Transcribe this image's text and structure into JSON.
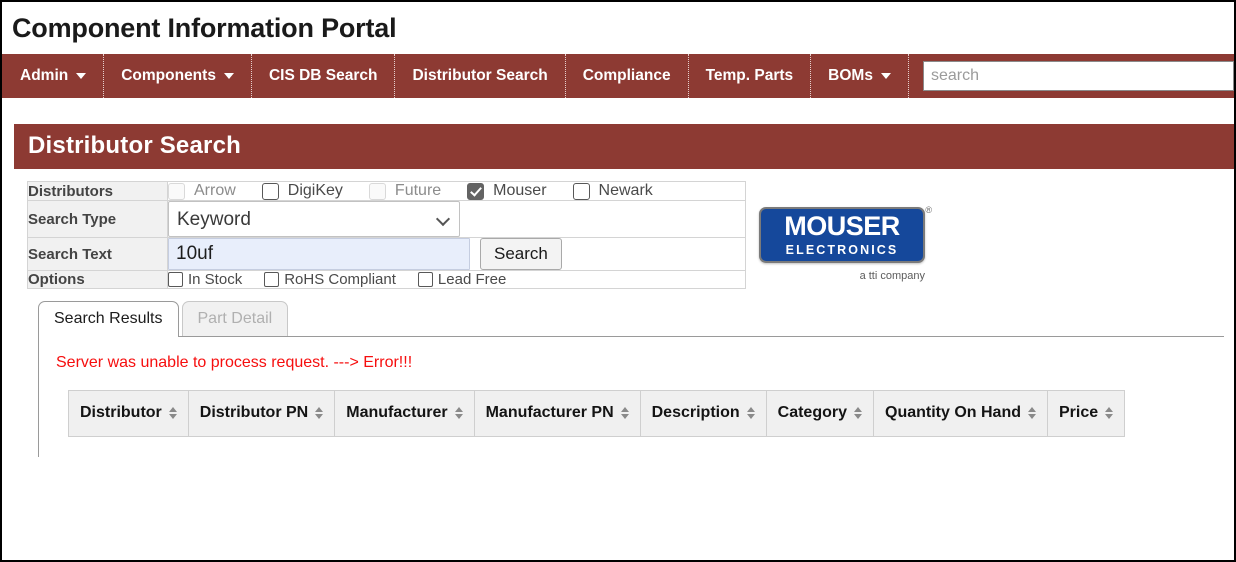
{
  "app": {
    "title": "Component Information Portal"
  },
  "nav": {
    "items": [
      {
        "label": "Admin",
        "has_caret": true
      },
      {
        "label": "Components",
        "has_caret": true
      },
      {
        "label": "CIS DB Search",
        "has_caret": false
      },
      {
        "label": "Distributor Search",
        "has_caret": false
      },
      {
        "label": "Compliance",
        "has_caret": false
      },
      {
        "label": "Temp. Parts",
        "has_caret": false
      },
      {
        "label": "BOMs",
        "has_caret": true
      }
    ],
    "search": {
      "value": "",
      "placeholder": "search"
    }
  },
  "panel": {
    "header": "Distributor Search",
    "form": {
      "distributors_label": "Distributors",
      "distributors": [
        {
          "label": "Arrow",
          "checked": false,
          "disabled": true
        },
        {
          "label": "DigiKey",
          "checked": false,
          "disabled": false
        },
        {
          "label": "Future",
          "checked": false,
          "disabled": true
        },
        {
          "label": "Mouser",
          "checked": true,
          "disabled": false
        },
        {
          "label": "Newark",
          "checked": false,
          "disabled": false
        }
      ],
      "search_type_label": "Search Type",
      "search_type_value": "Keyword",
      "search_type_options": [
        "Keyword"
      ],
      "search_text_label": "Search Text",
      "search_text_value": "10uf",
      "search_button": "Search",
      "options_label": "Options",
      "options": [
        {
          "label": "In Stock",
          "checked": false
        },
        {
          "label": "RoHS Compliant",
          "checked": false
        },
        {
          "label": "Lead Free",
          "checked": false
        }
      ]
    },
    "logo": {
      "main": "MOUSER",
      "sub": "ELECTRONICS",
      "registered": "®",
      "tagline": "a tti company",
      "color": "#15489b"
    }
  },
  "tabs": [
    {
      "label": "Search Results",
      "active": true
    },
    {
      "label": "Part Detail",
      "active": false
    }
  ],
  "results": {
    "error": "Server was unable to process request. ---> Error!!!",
    "error_color": "#f60e0e",
    "columns": [
      "Distributor",
      "Distributor PN",
      "Manufacturer",
      "Manufacturer PN",
      "Description",
      "Category",
      "Quantity On Hand",
      "Price"
    ],
    "rows": []
  },
  "theme": {
    "brand": "#8d3a33",
    "label_bg": "#f1f1f1"
  }
}
